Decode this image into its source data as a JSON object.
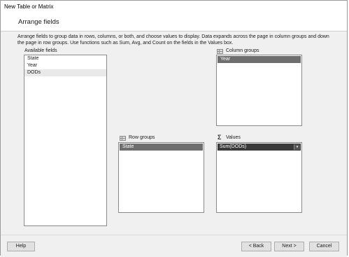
{
  "window": {
    "title": "New Table or Matrix"
  },
  "page": {
    "heading": "Arrange fields",
    "description": "Arrange fields to group data in rows, columns, or both, and choose values to display. Data expands across the page in column groups and down the page in row groups.  Use functions such as Sum, Avg, and Count on the fields in the Values box."
  },
  "available_fields": {
    "label": "Available fields",
    "items": [
      "State",
      "Year",
      "DODs"
    ]
  },
  "column_groups": {
    "label": "Column groups",
    "items": [
      "Year"
    ]
  },
  "row_groups": {
    "label": "Row groups",
    "items": [
      "State"
    ]
  },
  "values": {
    "label": "Values",
    "items": [
      "Sum(DODs)"
    ],
    "dropdown_glyph": "▾"
  },
  "buttons": {
    "help": "Help",
    "back": "< Back",
    "next": "Next >",
    "cancel": "Cancel"
  },
  "icons": {
    "column_groups": "grid-icon",
    "row_groups": "grid-icon",
    "values": "sigma-icon",
    "sigma_glyph": "Σ"
  }
}
